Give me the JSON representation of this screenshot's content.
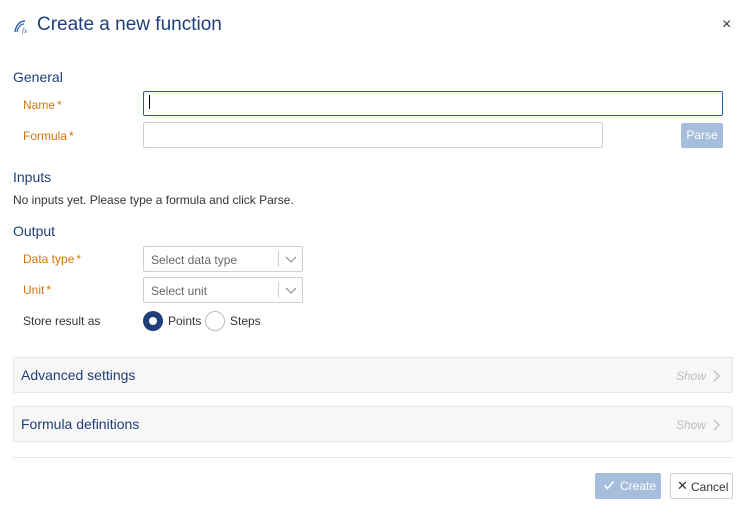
{
  "dialog": {
    "title": "Create a new function",
    "title_icon": "function-fx-icon",
    "close_glyph": "×"
  },
  "general": {
    "heading": "General",
    "name_label": "Name",
    "name_value": "",
    "formula_label": "Formula",
    "formula_value": "",
    "required_mark": "*",
    "parse_label": "Parse"
  },
  "inputs": {
    "heading": "Inputs",
    "empty_text": "No inputs yet. Please type a formula and click Parse."
  },
  "output": {
    "heading": "Output",
    "data_type_label": "Data type",
    "data_type_placeholder": "Select data type",
    "unit_label": "Unit",
    "unit_placeholder": "Select unit",
    "store_label": "Store result as",
    "options": [
      {
        "label": "Points",
        "selected": true
      },
      {
        "label": "Steps",
        "selected": false
      }
    ]
  },
  "panels": [
    {
      "title": "Advanced settings",
      "toggle": "Show"
    },
    {
      "title": "Formula definitions",
      "toggle": "Show"
    }
  ],
  "footer": {
    "create_label": "Create",
    "cancel_label": "Cancel",
    "cancel_glyph": "✕"
  },
  "colors": {
    "heading": "#1f3f78",
    "required_label": "#d9730d",
    "primary_disabled": "#a6bedb"
  }
}
